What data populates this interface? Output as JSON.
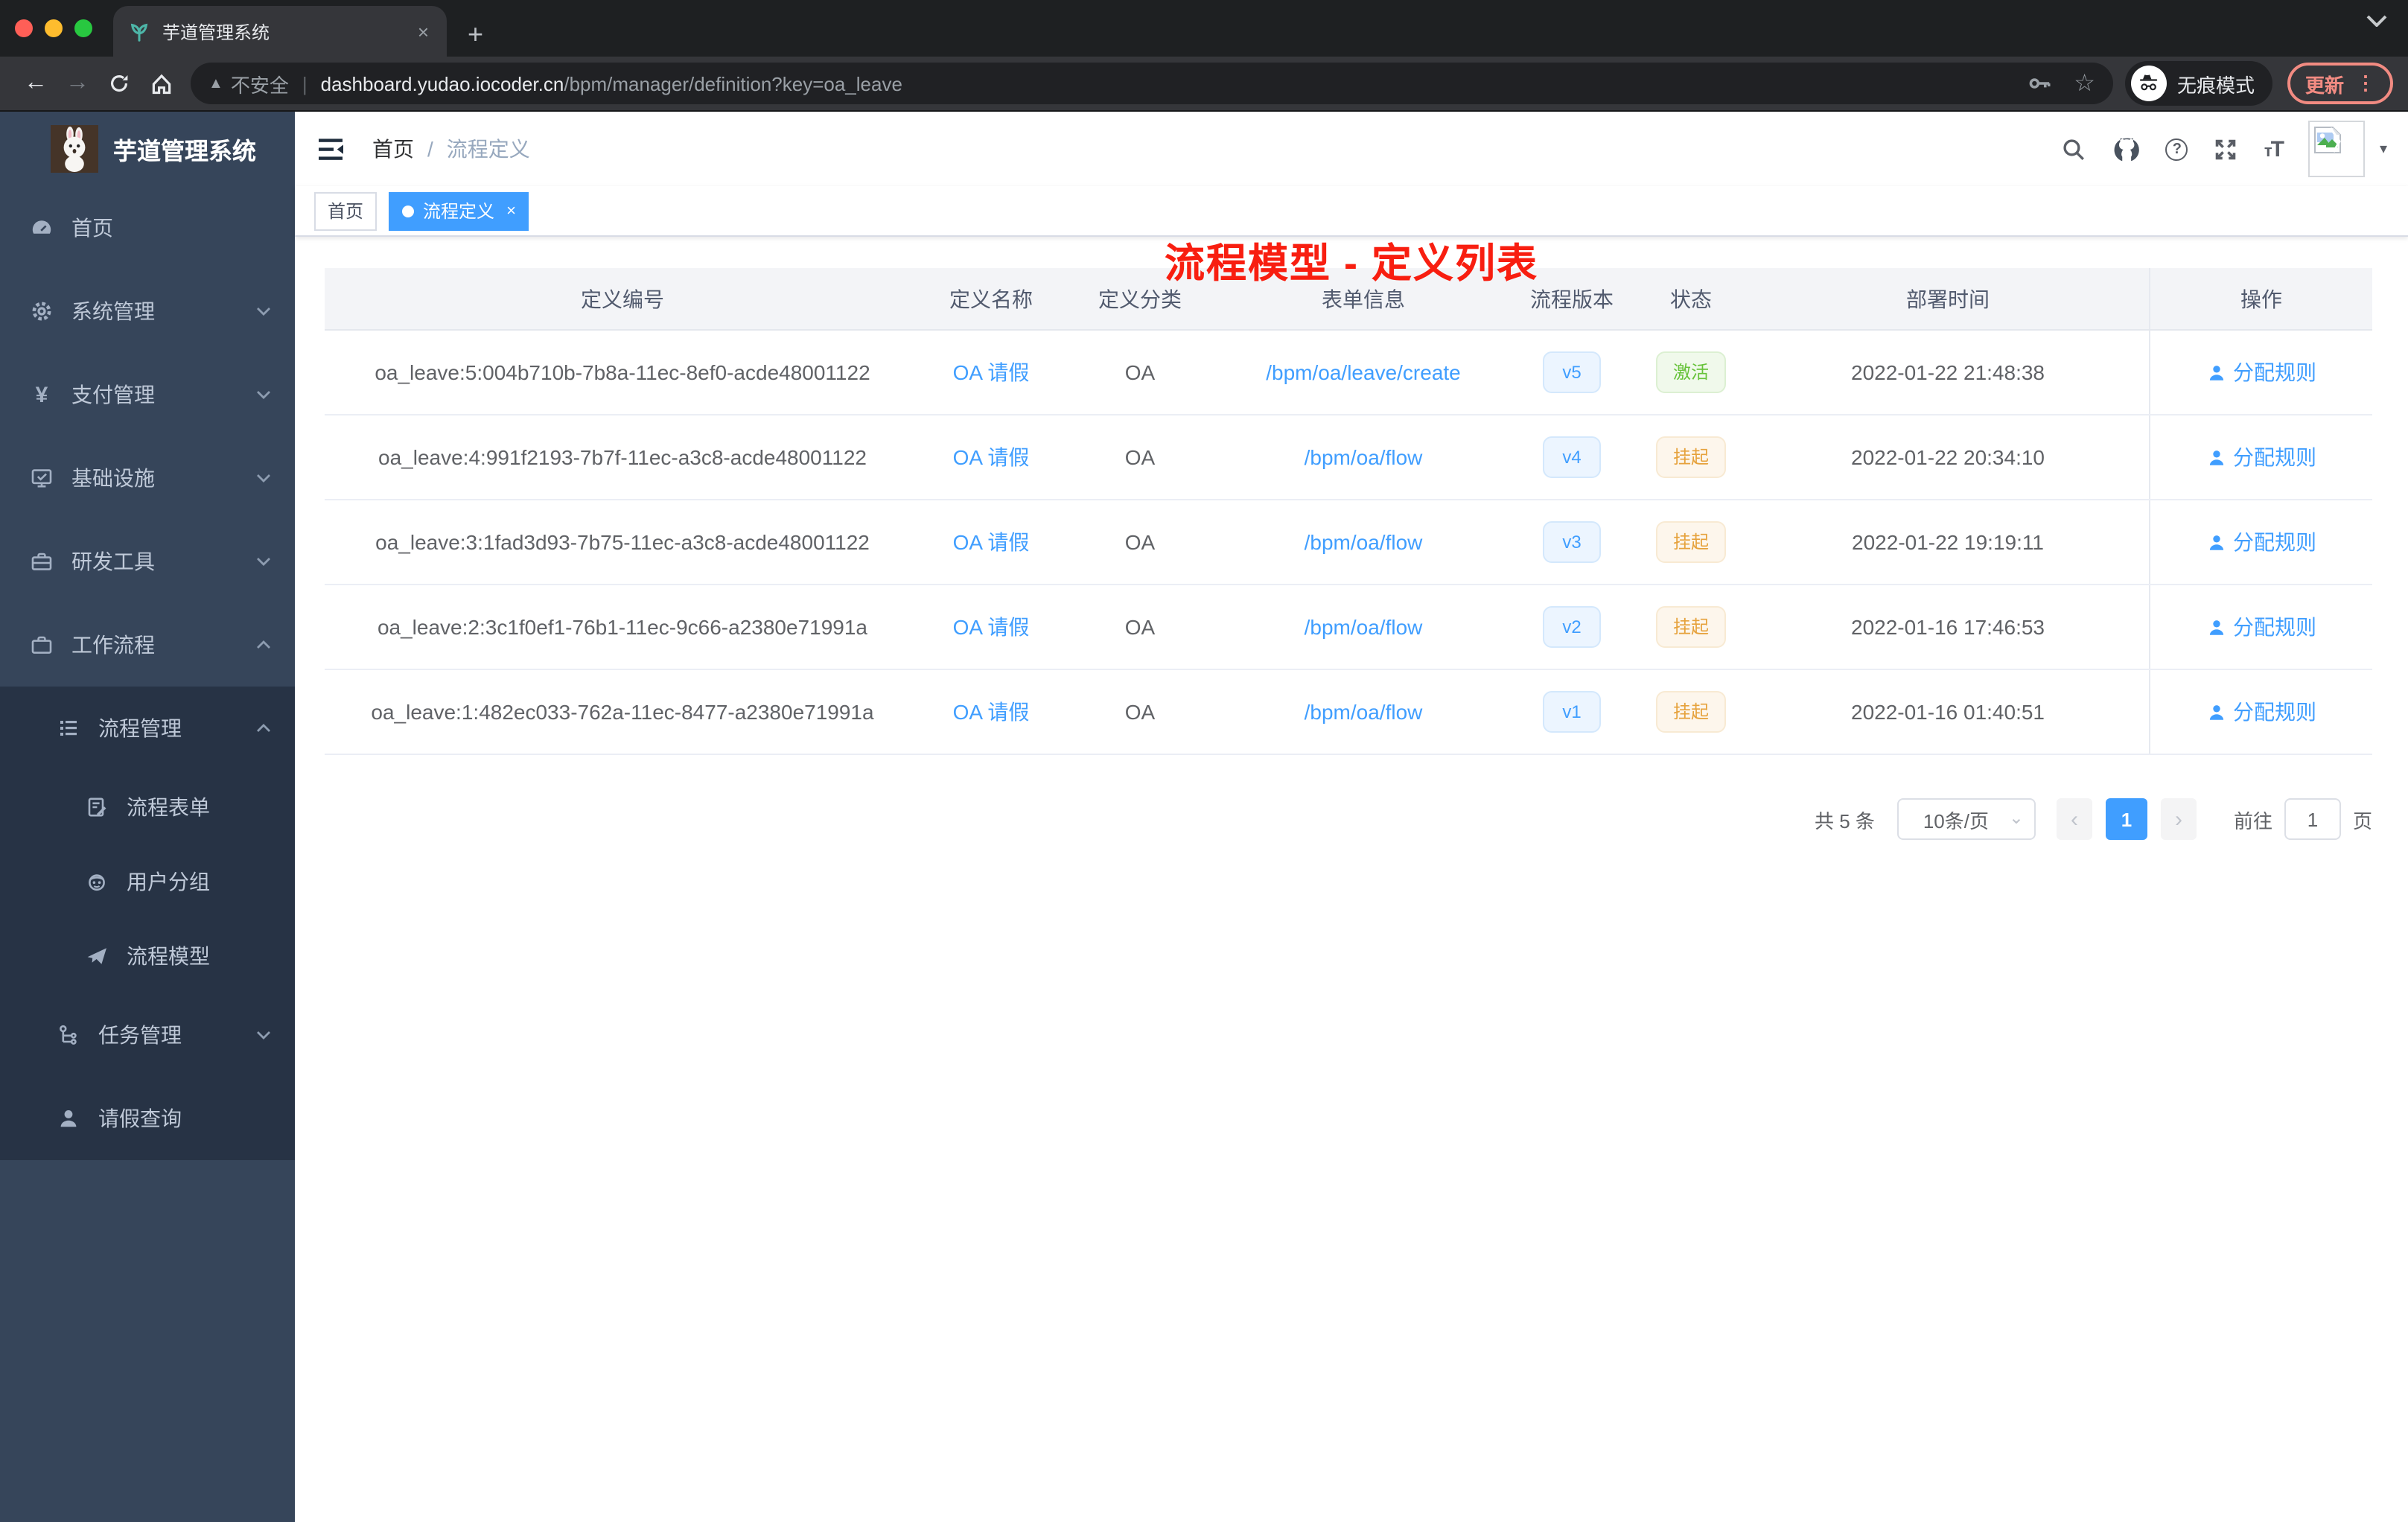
{
  "browser": {
    "tab": {
      "title": "芋道管理系统"
    },
    "url": {
      "security": "不安全",
      "host": "dashboard.yudao.iocoder.cn",
      "path": "/bpm/manager/definition?key=oa_leave"
    },
    "incognito_label": "无痕模式",
    "update_label": "更新"
  },
  "glyphs": {
    "back": "←",
    "forward": "→",
    "star": "☆",
    "warning": "▲",
    "divider": "|",
    "plus": "+",
    "close": "×",
    "caret_down": "▾",
    "dots_v": "⋮",
    "yen": "¥",
    "question": "?",
    "slash": "/",
    "prev": "‹",
    "next": "›",
    "select_caret": "⌄",
    "t_small": "т",
    "t_big": "T"
  },
  "sidebar": {
    "app_title": "芋道管理系统",
    "items": [
      {
        "label": "首页"
      },
      {
        "label": "系统管理"
      },
      {
        "label": "支付管理"
      },
      {
        "label": "基础设施"
      },
      {
        "label": "研发工具"
      },
      {
        "label": "工作流程"
      },
      {
        "label": "流程管理"
      },
      {
        "label": "流程表单"
      },
      {
        "label": "用户分组"
      },
      {
        "label": "流程模型"
      },
      {
        "label": "任务管理"
      },
      {
        "label": "请假查询"
      }
    ]
  },
  "header": {
    "breadcrumb": {
      "home": "首页",
      "separator": "/",
      "current": "流程定义"
    },
    "annotation": "流程模型 - 定义列表"
  },
  "tags": {
    "home": "首页",
    "active": "流程定义"
  },
  "table": {
    "columns": [
      "定义编号",
      "定义名称",
      "定义分类",
      "表单信息",
      "流程版本",
      "状态",
      "部署时间",
      "操作"
    ],
    "rows": [
      {
        "id": "oa_leave:5:004b710b-7b8a-11ec-8ef0-acde48001122",
        "name": "OA 请假",
        "category": "OA",
        "form": "/bpm/oa/leave/create",
        "version": "v5",
        "status": "激活",
        "time": "2022-01-22 21:48:38",
        "action": "分配规则"
      },
      {
        "id": "oa_leave:4:991f2193-7b7f-11ec-a3c8-acde48001122",
        "name": "OA 请假",
        "category": "OA",
        "form": "/bpm/oa/flow",
        "version": "v4",
        "status": "挂起",
        "time": "2022-01-22 20:34:10",
        "action": "分配规则"
      },
      {
        "id": "oa_leave:3:1fad3d93-7b75-11ec-a3c8-acde48001122",
        "name": "OA 请假",
        "category": "OA",
        "form": "/bpm/oa/flow",
        "version": "v3",
        "status": "挂起",
        "time": "2022-01-22 19:19:11",
        "action": "分配规则"
      },
      {
        "id": "oa_leave:2:3c1f0ef1-76b1-11ec-9c66-a2380e71991a",
        "name": "OA 请假",
        "category": "OA",
        "form": "/bpm/oa/flow",
        "version": "v2",
        "status": "挂起",
        "time": "2022-01-16 17:46:53",
        "action": "分配规则"
      },
      {
        "id": "oa_leave:1:482ec033-762a-11ec-8477-a2380e71991a",
        "name": "OA 请假",
        "category": "OA",
        "form": "/bpm/oa/flow",
        "version": "v1",
        "status": "挂起",
        "time": "2022-01-16 01:40:51",
        "action": "分配规则"
      }
    ]
  },
  "pagination": {
    "total": "共 5 条",
    "page_size": "10条/页",
    "current": "1",
    "goto": "前往",
    "unit": "页",
    "goto_value": "1"
  },
  "colors": {
    "primary": "#409eff",
    "success": "#67c23a",
    "warning": "#e6a23c",
    "annotation": "#f81e10",
    "sidebar_bg": "#36455a"
  }
}
